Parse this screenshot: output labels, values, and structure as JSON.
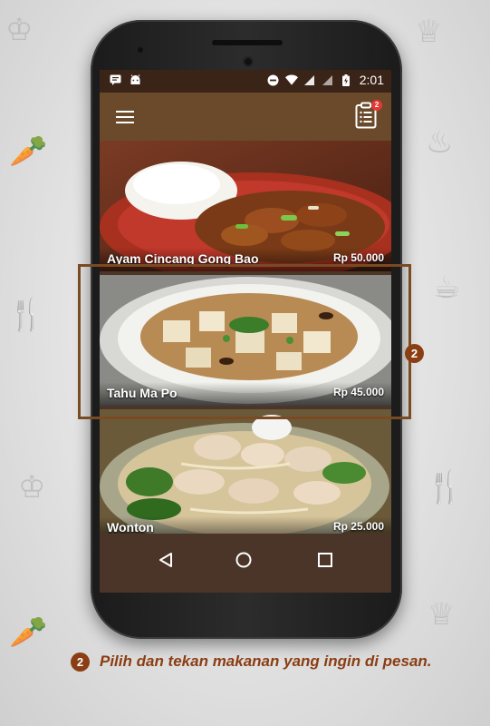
{
  "status_bar": {
    "time": "2:01",
    "left_icons": [
      "message-icon",
      "android-icon"
    ],
    "right_icons": [
      "dnd-icon",
      "wifi-icon",
      "signal-icon",
      "signal-icon",
      "battery-icon"
    ]
  },
  "app_bar": {
    "menu_icon": "hamburger-icon",
    "orders_icon": "clipboard-list-icon",
    "orders_badge": "2"
  },
  "menu_items": [
    {
      "name": "Ayam Cincang Gong Bao",
      "price": "Rp 50.000"
    },
    {
      "name": "Tahu Ma Po",
      "price": "Rp 45.000"
    },
    {
      "name": "Wonton",
      "price": "Rp 25.000"
    }
  ],
  "nav_bar": {
    "icons": [
      "back-icon",
      "home-icon",
      "recents-icon"
    ]
  },
  "callout": {
    "step_number": "2"
  },
  "instruction": {
    "step_number": "2",
    "text": "Pilih dan tekan makanan yang ingin di pesan."
  },
  "colors": {
    "app_bar": "#6a4a2b",
    "status_bar": "#3a2418",
    "accent": "#8b3d13",
    "badge": "#e53935"
  }
}
